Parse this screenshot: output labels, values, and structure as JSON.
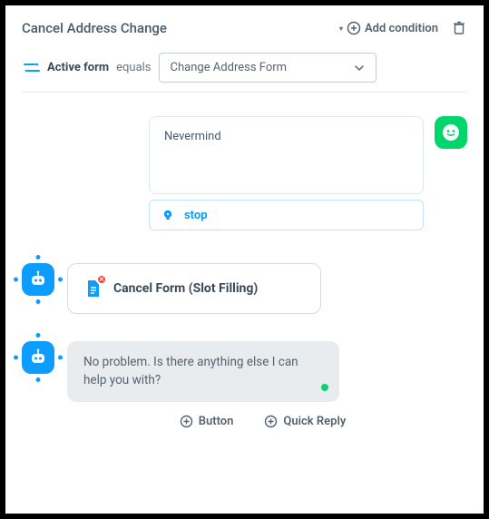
{
  "header": {
    "title": "Cancel Address Change",
    "add_condition_label": "Add condition"
  },
  "condition": {
    "field": "Active form",
    "operator": "equals",
    "value": "Change Address Form"
  },
  "user_message": {
    "text": "Nevermind"
  },
  "intent": {
    "label": "stop"
  },
  "action": {
    "label": "Cancel Form (Slot Filling)"
  },
  "bot_reply": {
    "text": "No problem. Is there anything else I can help you with?"
  },
  "footer": {
    "button_label": "Button",
    "quick_reply_label": "Quick Reply"
  }
}
